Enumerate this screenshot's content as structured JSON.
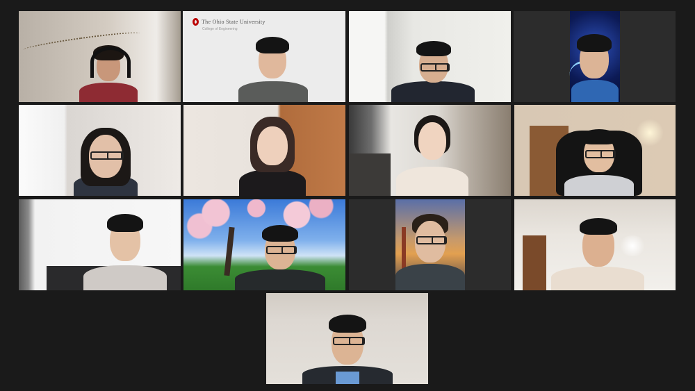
{
  "meeting": {
    "view": "gallery",
    "participant_count": 13,
    "active_speaker_index": 1
  },
  "participants": [
    {
      "name": "",
      "background": "bedroom-string-lights",
      "headphones": true,
      "glasses": false
    },
    {
      "name": "",
      "background": "virtual-ohio-state",
      "logo_text": "The Ohio State University",
      "logo_subtext": "College of Engineering",
      "headphones": false,
      "glasses": false
    },
    {
      "name": "",
      "background": "white-wall",
      "headphones": false,
      "glasses": true
    },
    {
      "name": "",
      "background": "virtual-space",
      "headphones": false,
      "glasses": false
    },
    {
      "name": "",
      "background": "white-room",
      "headphones": false,
      "glasses": true
    },
    {
      "name": "",
      "background": "wooden-door",
      "headphones": false,
      "glasses": false
    },
    {
      "name": "",
      "background": "kitchen",
      "headphones": false,
      "glasses": false
    },
    {
      "name": "",
      "background": "room-with-door",
      "headphones": false,
      "glasses": true
    },
    {
      "name": "",
      "background": "white-wall-sofa",
      "headphones": false,
      "glasses": false
    },
    {
      "name": "",
      "background": "virtual-magnolia-park",
      "headphones": false,
      "glasses": true
    },
    {
      "name": "",
      "background": "virtual-golden-gate",
      "headphones": false,
      "glasses": true
    },
    {
      "name": "",
      "background": "ceiling-light-room",
      "headphones": false,
      "glasses": false
    },
    {
      "name": "",
      "background": "beige-wall",
      "headphones": false,
      "glasses": true
    }
  ],
  "colors": {
    "window_bg": "#1a1a1a",
    "active_speaker_border": "#c4d15a",
    "tile_bg": "#2c2c2c"
  }
}
